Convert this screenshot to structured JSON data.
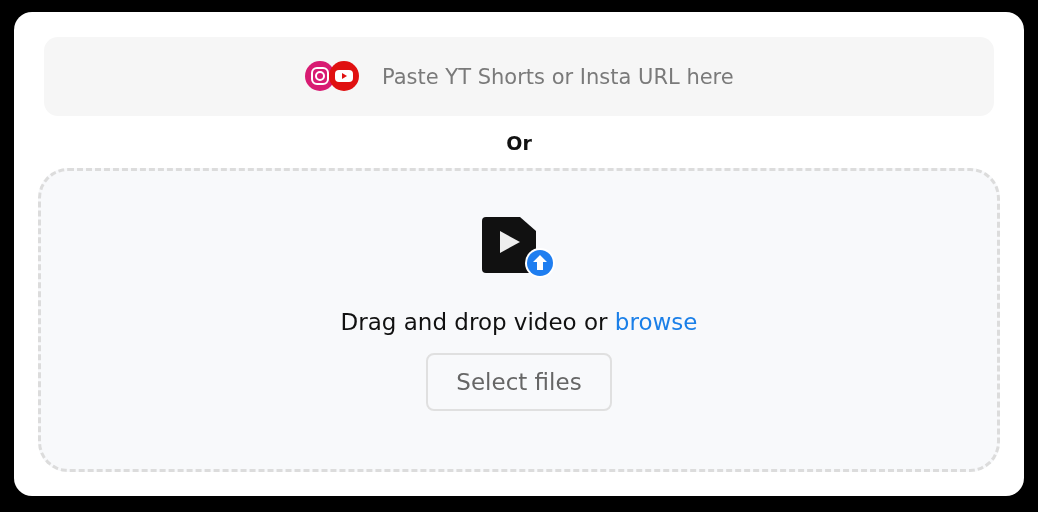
{
  "url_field": {
    "placeholder": "Paste YT Shorts or Insta URL here"
  },
  "separator": "Or",
  "dropzone": {
    "text": "Drag and drop video or",
    "link": "browse",
    "button": "Select files"
  }
}
